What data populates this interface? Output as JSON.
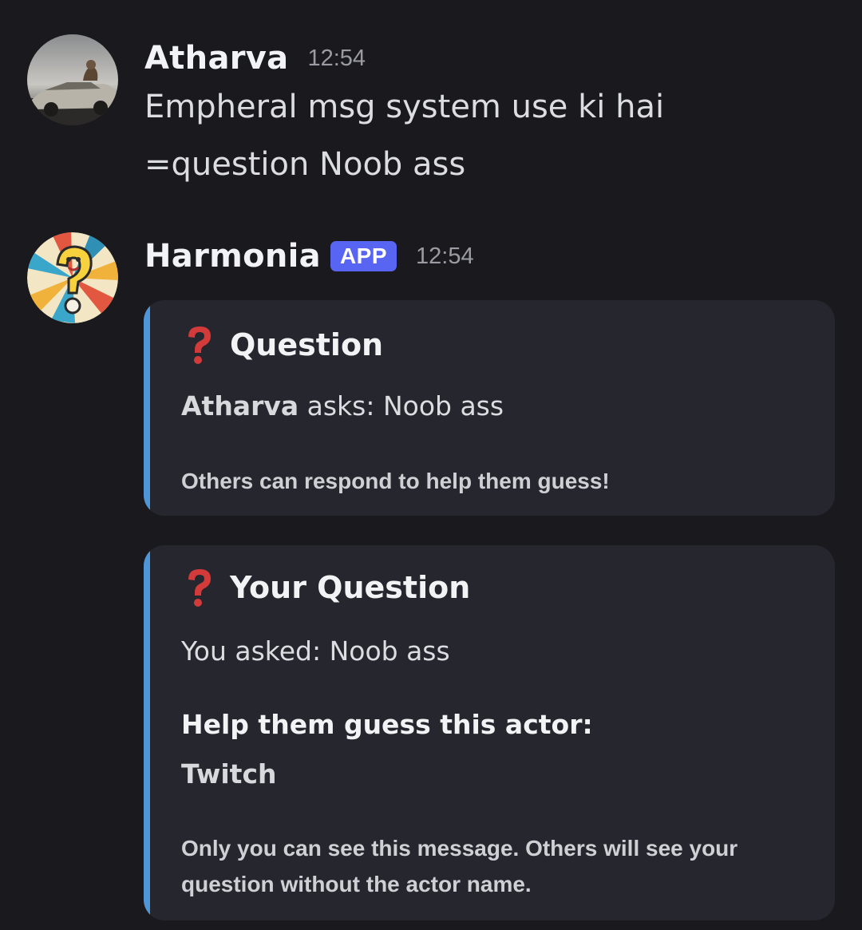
{
  "messages": [
    {
      "author": "Atharva",
      "time": "12:54",
      "lines": [
        "Empheral msg system use ki hai",
        "=question Noob ass"
      ]
    },
    {
      "author": "Harmonia",
      "badge": "APP",
      "time": "12:54",
      "embeds": [
        {
          "title": "Question",
          "asker": "Atharva",
          "asks_text": " asks: Noob ass",
          "footer": "Others can respond to help them guess!"
        },
        {
          "title": "Your Question",
          "asked_text": "You asked: Noob ass",
          "help_label": "Help them guess this actor:",
          "actor": "Twitch",
          "footer_line1": "Only you can see this message. Others will see your",
          "footer_line2": "question without the actor name."
        }
      ]
    }
  ],
  "colors": {
    "background": "#1a1a1e",
    "embed_background": "#26272e",
    "embed_accent": "#4e96d8",
    "app_badge": "#5865f2",
    "question_icon": "#d33a3a"
  },
  "icons": {
    "avatar_1": "car-photo-avatar",
    "avatar_2": "question-mark-cartoon-avatar",
    "title_icon": "red-question-mark-icon"
  }
}
